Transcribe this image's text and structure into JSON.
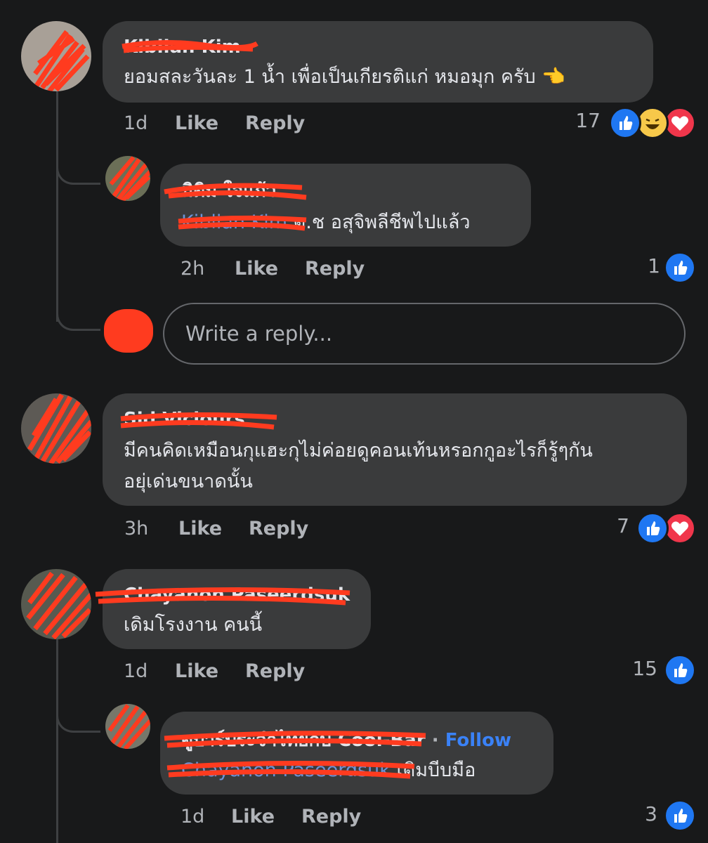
{
  "comments": [
    {
      "author": "Kiblian Kim",
      "text": "ยอมสละวันละ 1 น้ำ เพื่อเป็นเกียรติแก่ หมอมุก ครับ",
      "emoji": "👈",
      "time": "1d",
      "like_label": "Like",
      "reply_label": "Reply",
      "reaction_count": "17",
      "reactions": [
        "like-icon",
        "haha-icon",
        "love-icon"
      ]
    },
    {
      "author": "มิติม ใจแก้ว",
      "mention": "Kiblian Kim",
      "text": "ด.ช อสุจิพลีชีพไปแล้ว",
      "time": "2h",
      "like_label": "Like",
      "reply_label": "Reply",
      "reaction_count": "1",
      "reactions": [
        "like-icon"
      ]
    },
    {
      "author": "Sid Viciours",
      "text_line1": "มีคนคิดเหมือนกุแฮะกุไม่ค่อยดูคอนเท้นหรอกกูอะไรก็รู้ๆกัน",
      "text_line2": "อยุ่เด่นขนาดนั้น",
      "time": "3h",
      "like_label": "Like",
      "reply_label": "Reply",
      "reaction_count": "7",
      "reactions": [
        "like-icon",
        "love-icon"
      ]
    },
    {
      "author": "Chayanon Paseerdsuk",
      "text": "เดิมโรงงาน คนนี้",
      "time": "1d",
      "like_label": "Like",
      "reply_label": "Reply",
      "reaction_count": "15",
      "reactions": [
        "like-icon"
      ]
    },
    {
      "author": "ดูบาร์ประจำไทยกับ Cool-Bar",
      "separator": "·",
      "follow_label": "Follow",
      "mention": "Chayanon Paseerdsuk",
      "text": "เดิมบีบมือ",
      "time": "1d",
      "like_label": "Like",
      "reply_label": "Reply",
      "reaction_count": "3",
      "reactions": [
        "like-icon"
      ]
    }
  ],
  "reply_box": {
    "placeholder": "Write a reply..."
  },
  "colors": {
    "background": "#18191a",
    "bubble": "#3a3b3c",
    "text": "#e4e6eb",
    "meta": "#b0b3b8",
    "mention": "#6b93d8",
    "follow": "#3a82f7",
    "like": "#1f77f2",
    "love": "#f0364b",
    "haha": "#f7c84a",
    "redaction": "#ff3b1f"
  }
}
